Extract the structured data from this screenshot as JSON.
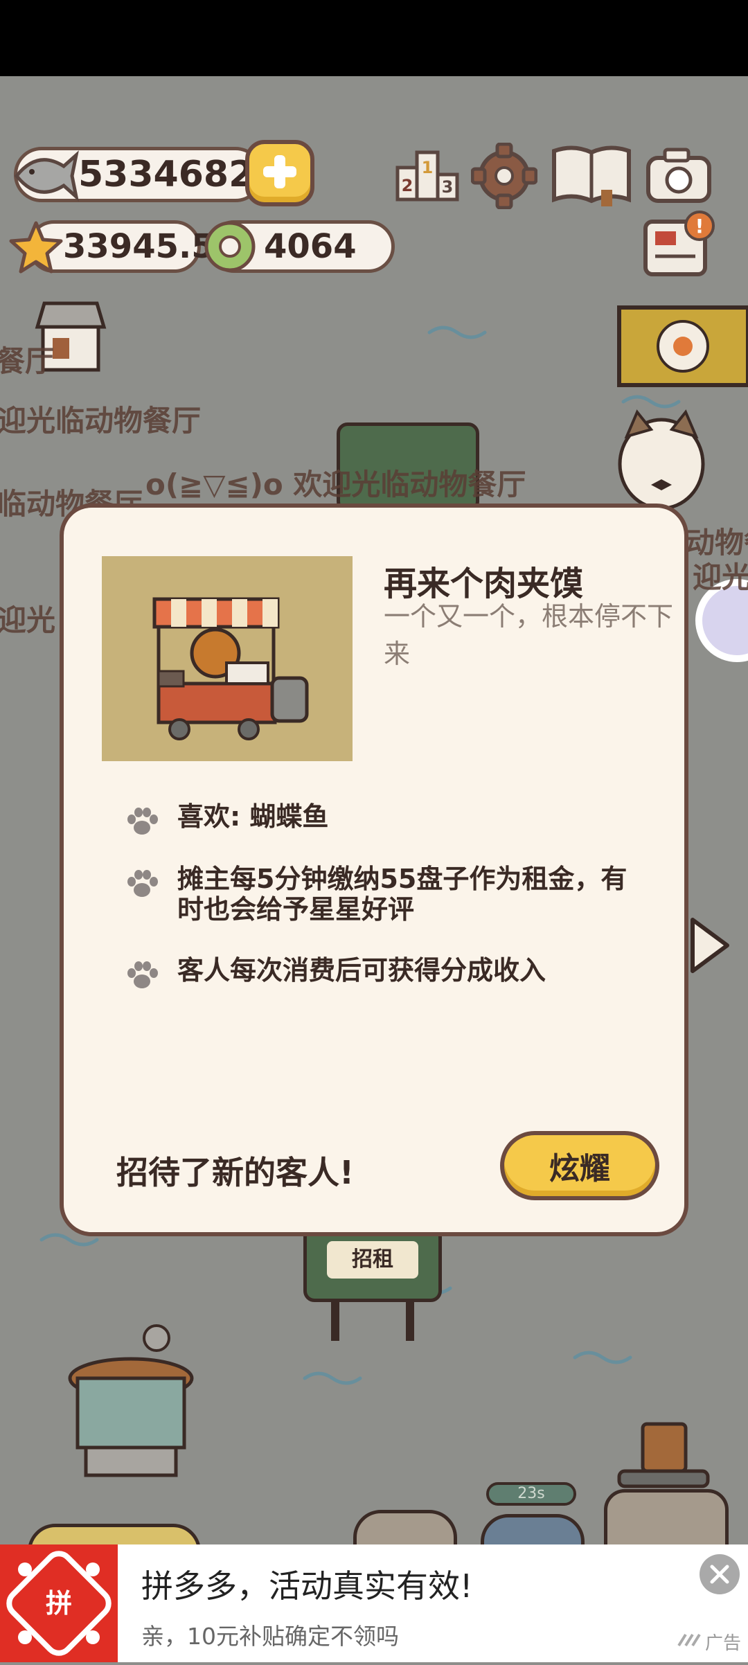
{
  "resources": {
    "fish": "5334682",
    "stars": "33945.5",
    "coins": "4064"
  },
  "background": {
    "restaurant_label": "餐厅",
    "welcome_1": "迎光临动物餐厅",
    "welcome_2": "o(≧▽≦)o 欢迎光临动物餐厅",
    "welcome_3": "临动物餐厅",
    "welcome_4": "迎光",
    "right_fragment_1": "动物餐",
    "right_fragment_2": "迎光临",
    "rent_sign": "招租",
    "timer": "23s"
  },
  "modal": {
    "title": "再来个肉夹馍",
    "subtitle": "一个又一个，根本停不下来",
    "features": [
      "喜欢: 蝴蝶鱼",
      "摊主每5分钟缴纳55盘子作为租金，有时也会给予星星好评",
      "客人每次消费后可获得分成收入"
    ],
    "footer_text": "招待了新的客人!",
    "button_label": "炫耀"
  },
  "ad": {
    "logo_text": "拼",
    "title": "拼多多，活动真实有效!",
    "subtitle": "亲，10元补贴确定不领吗",
    "label": "广告"
  },
  "colors": {
    "accent_yellow": "#f5c94a",
    "border_brown": "#6b4a40",
    "panel_cream": "#fbf4ea",
    "ad_red": "#e02e24"
  }
}
